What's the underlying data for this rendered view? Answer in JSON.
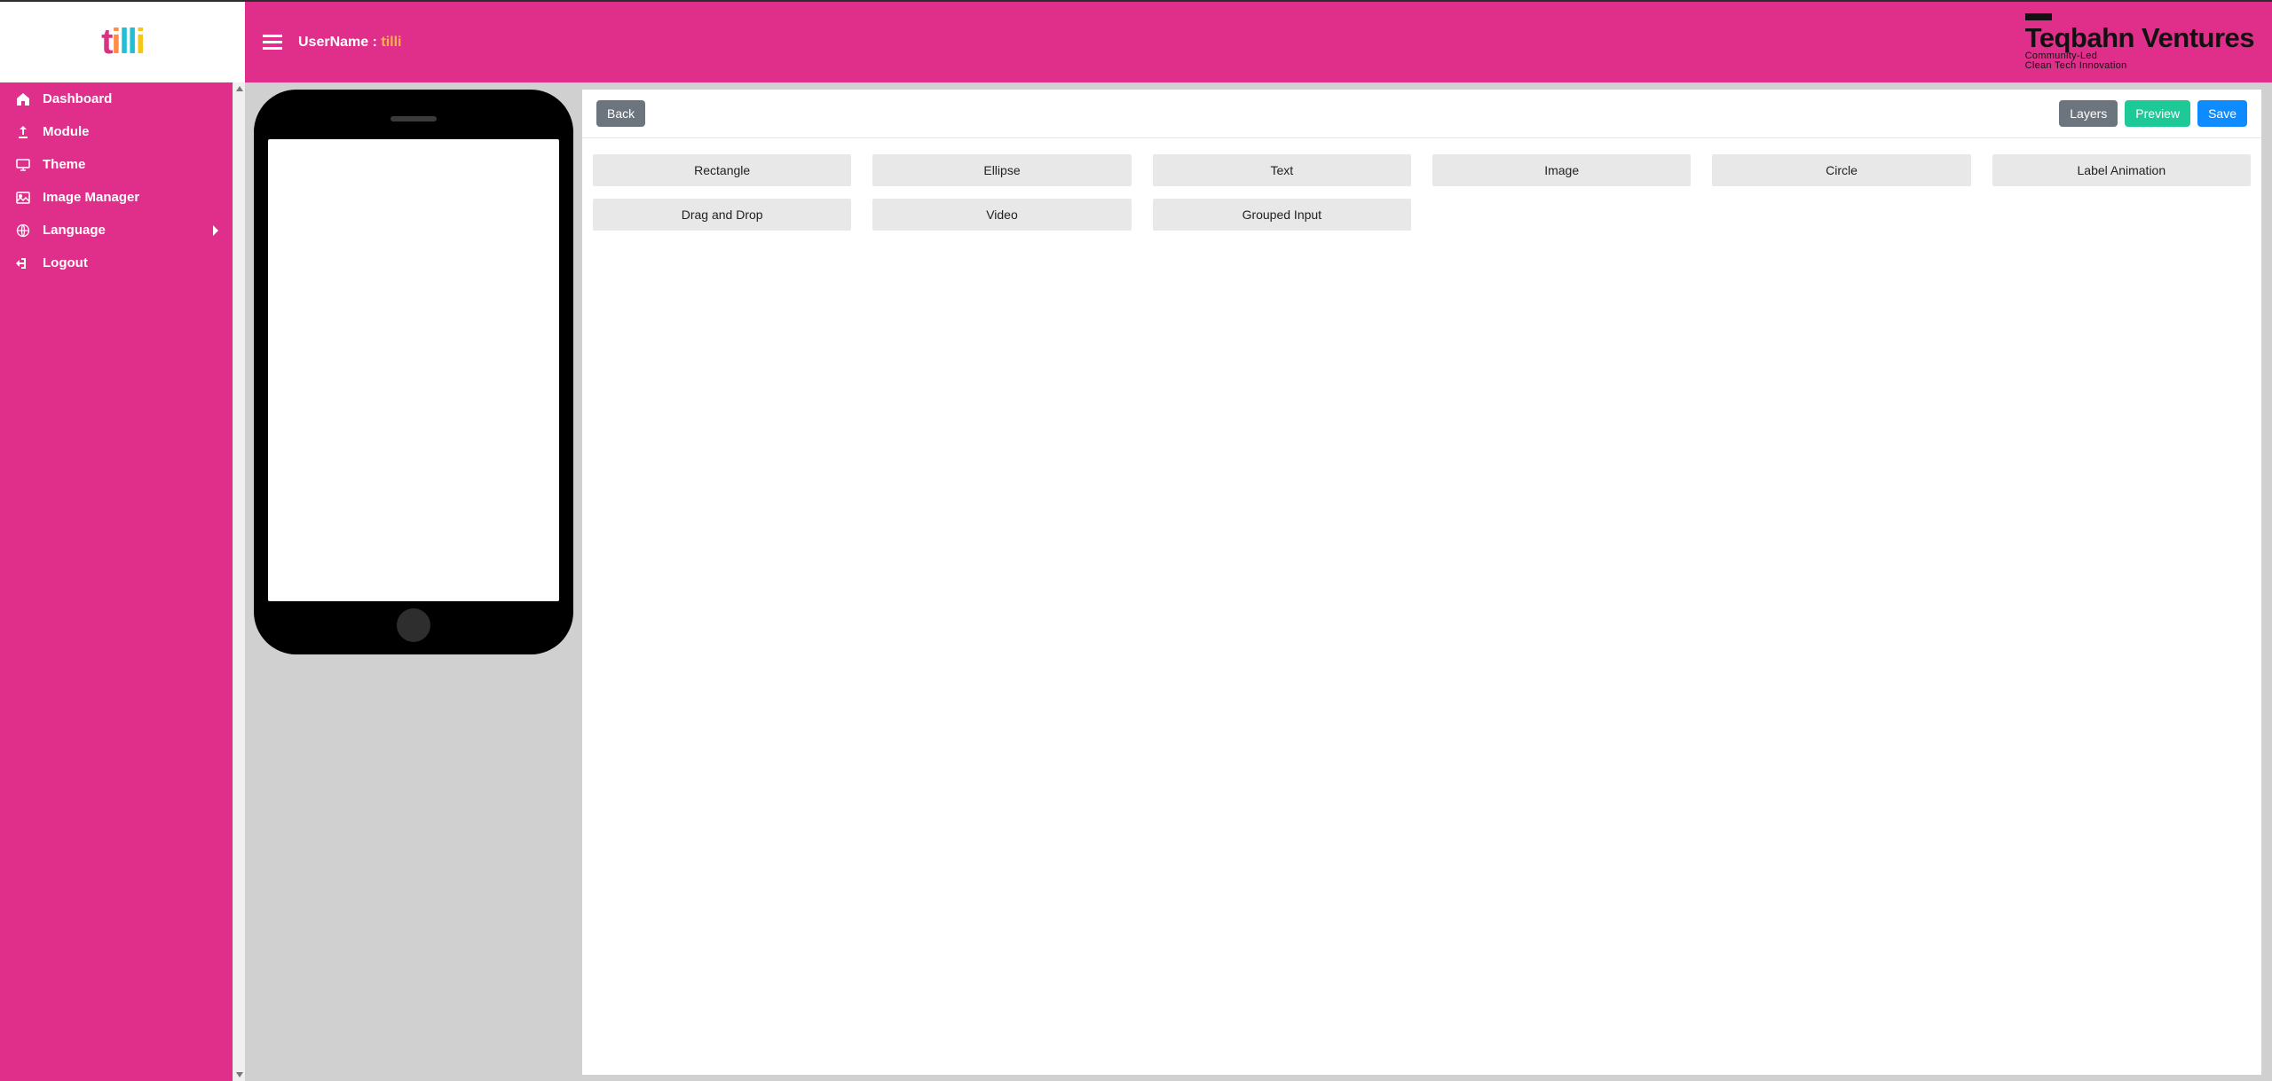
{
  "logo_text": "tilli",
  "header": {
    "username_label": "UserName : ",
    "username_value": "tilli",
    "brand_title": "Teqbahn Ventures",
    "brand_line1": "Community-Led",
    "brand_line2": "Clean Tech Innovation"
  },
  "sidebar": {
    "items": [
      {
        "label": "Dashboard"
      },
      {
        "label": "Module"
      },
      {
        "label": "Theme"
      },
      {
        "label": "Image Manager"
      },
      {
        "label": "Language"
      },
      {
        "label": "Logout"
      }
    ]
  },
  "panel": {
    "back": "Back",
    "layers": "Layers",
    "preview": "Preview",
    "save": "Save",
    "tools": [
      "Rectangle",
      "Ellipse",
      "Text",
      "Image",
      "Circle",
      "Label Animation",
      "Drag and Drop",
      "Video",
      "Grouped Input"
    ]
  }
}
